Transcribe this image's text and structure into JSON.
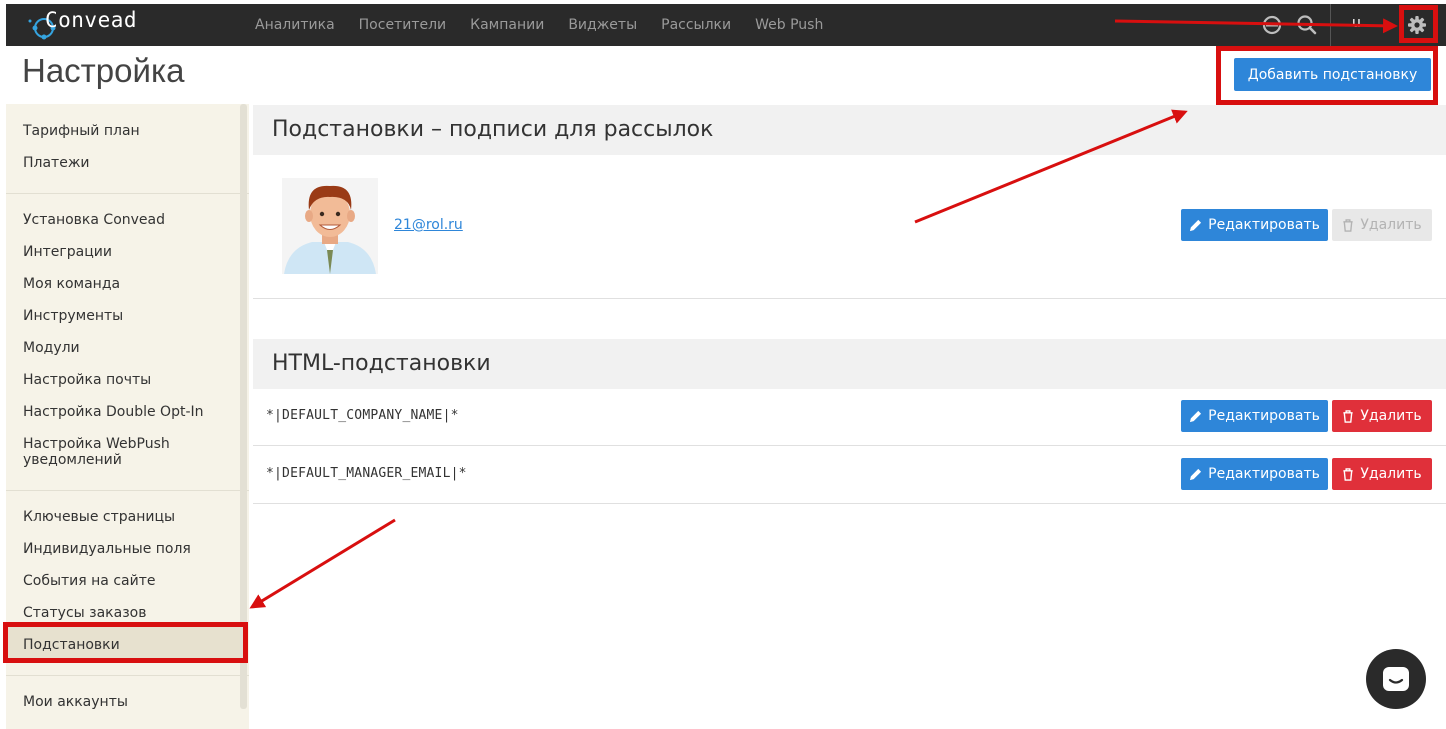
{
  "app": {
    "logo_text": "Convead",
    "nav": [
      "Аналитика",
      "Посетители",
      "Кампании",
      "Виджеты",
      "Рассылки",
      "Web Push"
    ],
    "user_text": "u",
    "icons": [
      "help-icon",
      "search-icon",
      "gear-icon"
    ]
  },
  "header": {
    "title": "Настройка",
    "add_button": "Добавить подстановку"
  },
  "sidebar": {
    "group1": [
      "Тарифный план",
      "Платежи"
    ],
    "group2": [
      "Установка Convead",
      "Интеграции",
      "Моя команда",
      "Инструменты",
      "Модули",
      "Настройка почты",
      "Настройка Double Opt-In",
      "Настройка WebPush уведомлений"
    ],
    "group3": [
      "Ключевые страницы",
      "Индивидуальные поля",
      "События на сайте",
      "Статусы заказов",
      "Подстановки"
    ],
    "group4": [
      "Мои аккаунты"
    ],
    "active_item": "Подстановки"
  },
  "main": {
    "signatures_title": "Подстановки – подписи для рассылок",
    "signature_email": "21@rol.ru",
    "html_title": "HTML-подстановки",
    "html_rows": [
      "*|DEFAULT_COMPANY_NAME|*",
      "*|DEFAULT_MANAGER_EMAIL|*"
    ],
    "edit_label": "Редактировать",
    "delete_label": "Удалить"
  },
  "colors": {
    "accent": "#2e86d9",
    "danger": "#e0303a",
    "annotation": "#d80f0f"
  }
}
